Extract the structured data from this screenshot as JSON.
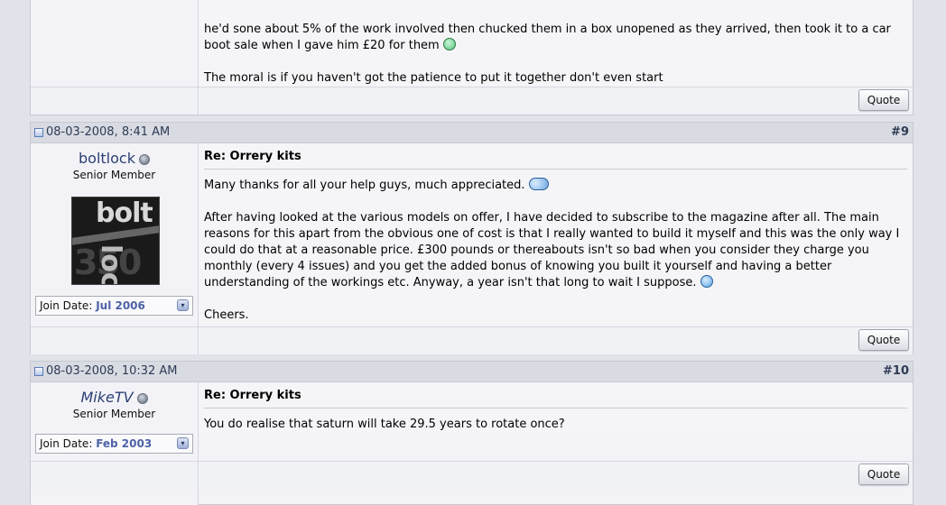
{
  "post8": {
    "lines": [
      "he'd sone about 5% of the work involved then chucked them in a box unopened as they arrived, then took it to a car",
      "boot sale when I gave him £20 for them",
      "The moral is if you haven't got the patience to put it together don't even start"
    ],
    "quote_label": "Quote"
  },
  "post9": {
    "date": "08-03-2008, 8:41 AM",
    "number": "#9",
    "username": "boltlock",
    "user_title": "Senior Member",
    "avatar_text": [
      "bolt",
      "350",
      "lock"
    ],
    "join_label": "Join Date:",
    "join_value": "Jul 2006",
    "title": "Re: Orrery kits",
    "para1": "Many thanks for all your help guys, much appreciated.",
    "para2_lines": [
      "After having looked at the various models on offer, I have decided to subscribe to the magazine after all. The main",
      "reasons for this apart from the obvious one of cost is that I really wanted to build it myself and this was the only way I",
      "could do that at a reasonable price. £300 pounds or thereabouts isn't so bad when you consider they charge you",
      "monthly (every 4 issues) and you get the added bonus of knowing you built it yourself and having a better",
      "understanding of the workings etc. Anyway, a year isn't that long to wait I suppose."
    ],
    "para3": "Cheers.",
    "quote_label": "Quote"
  },
  "post10": {
    "date": "08-03-2008, 10:32 AM",
    "number": "#10",
    "username": "MikeTV",
    "user_title": "Senior Member",
    "join_label": "Join Date:",
    "join_value": "Feb 2003",
    "title": "Re: Orrery kits",
    "para1": "You do realise that saturn will take 29.5 years to rotate once?",
    "quote_label": "Quote"
  },
  "icons": {
    "post_icon": "post-icon",
    "online_status": "offline-status-icon",
    "smileys": [
      "green-smiley-icon",
      "thumbs-up-smiley-icon",
      "wink-smiley-icon"
    ]
  }
}
